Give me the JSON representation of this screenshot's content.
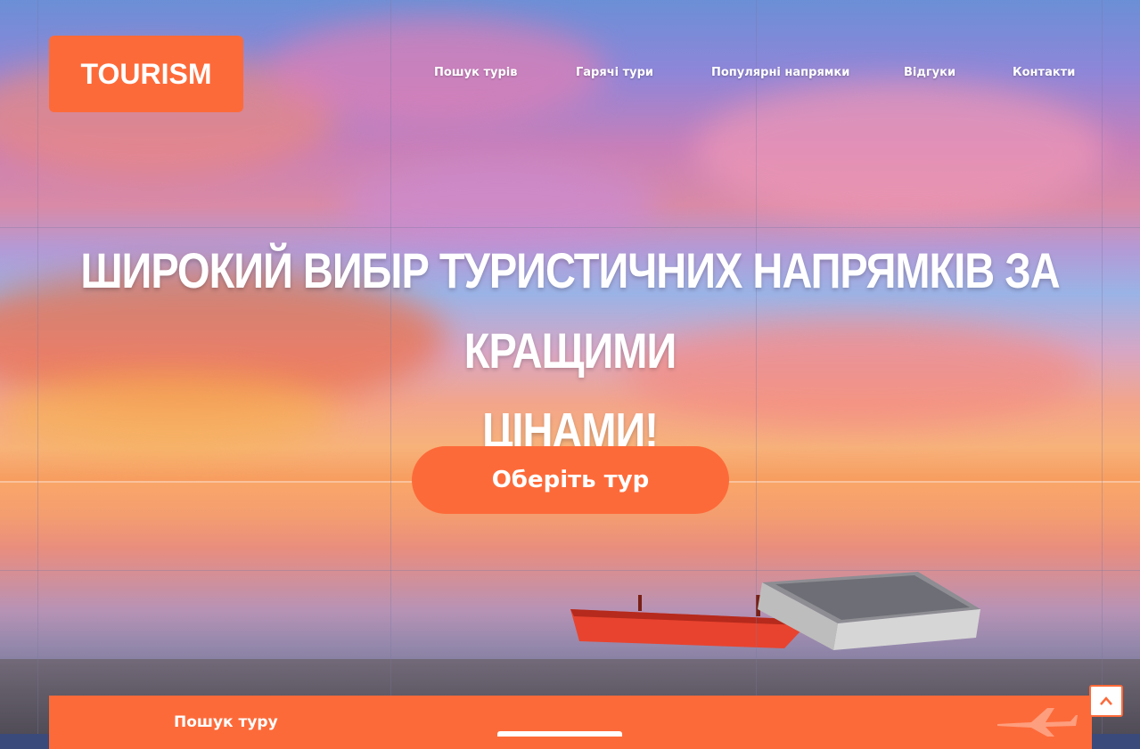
{
  "brand": {
    "logo_text": "TOURISM",
    "accent_color": "#fd6a39"
  },
  "nav": {
    "items": [
      {
        "label": "Пошук турів"
      },
      {
        "label": "Гарячі тури"
      },
      {
        "label": "Популярні напрямки"
      },
      {
        "label": "Відгуки"
      },
      {
        "label": "Контакти"
      }
    ]
  },
  "hero": {
    "headline_line1": "ШИРОКИЙ ВИБІР ТУРИСТИЧНИХ НАПРЯМКІВ ЗА КРАЩИМИ",
    "headline_line2": "ЦІНАМИ!",
    "cta_label": "Оберіть тур",
    "background_icon": "sunset-sea-boats-image"
  },
  "search": {
    "title": "Пошук туру",
    "icon": "airplane-icon"
  },
  "scroll_top": {
    "icon": "chevron-up-icon"
  }
}
